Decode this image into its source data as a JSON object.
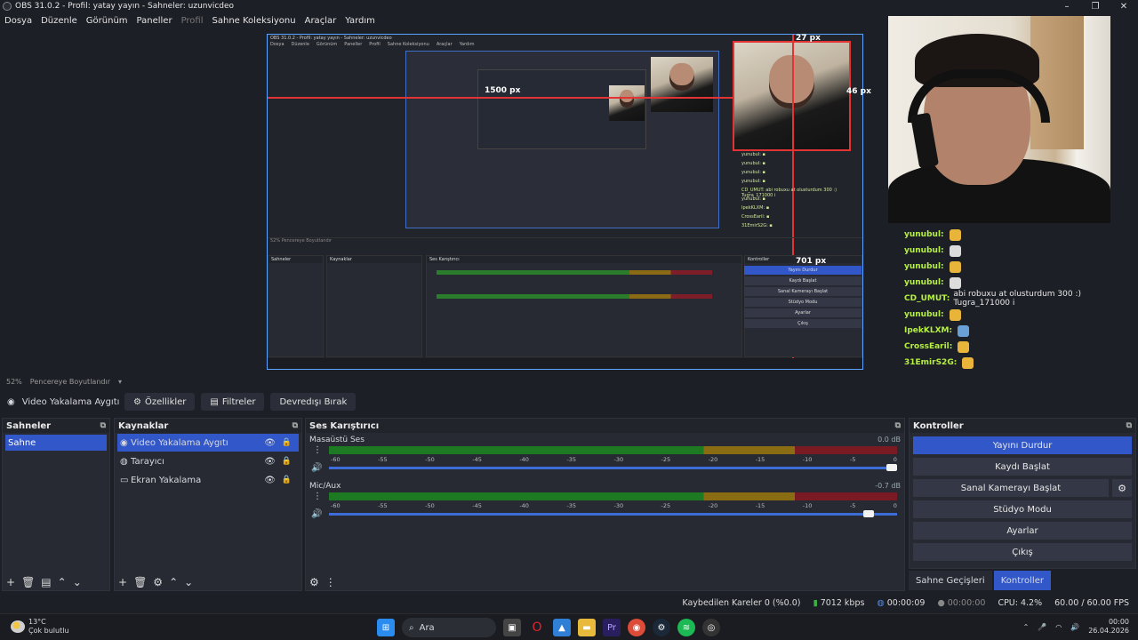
{
  "window": {
    "title": "OBS 31.0.2 - Profil: yatay yayın - Sahneler: uzunvicdeo"
  },
  "menu": [
    "Dosya",
    "Düzenle",
    "Görünüm",
    "Paneller",
    "Profil",
    "Sahne Koleksiyonu",
    "Araçlar",
    "Yardım"
  ],
  "preview": {
    "measure_top": "27 px",
    "measure_left": "1500 px",
    "measure_right": "46 px",
    "measure_bottom": "701 px"
  },
  "chat": [
    {
      "user": "yunubul:",
      "text": "",
      "emote_color": "#e8b53a"
    },
    {
      "user": "yunubul:",
      "text": "",
      "emote_color": "#dcdcdc"
    },
    {
      "user": "yunubul:",
      "text": "",
      "emote_color": "#e8b53a"
    },
    {
      "user": "yunubul:",
      "text": "",
      "emote_color": "#dcdcdc"
    },
    {
      "user": "CD_UMUT:",
      "text": "abi robuxu at olusturdum 300 :) Tugra_171000 i",
      "emote_color": ""
    },
    {
      "user": "yunubul:",
      "text": "",
      "emote_color": "#e8b53a"
    },
    {
      "user": "IpekKLXM:",
      "text": "",
      "emote_color": "#6aa0d8"
    },
    {
      "user": "CrossEaril:",
      "text": "",
      "emote_color": "#e8b53a"
    },
    {
      "user": "31EmirS2G:",
      "text": "",
      "emote_color": "#e8b53a"
    }
  ],
  "zoom": {
    "level": "52%",
    "resize": "Pencereye Boyutlandır"
  },
  "source_toolbar": {
    "source_name": "Video Yakalama Aygıtı",
    "properties": "Özellikler",
    "filters": "Filtreler",
    "deactivate": "Devredışı Bırak"
  },
  "scenes": {
    "title": "Sahneler",
    "items": [
      "Sahne"
    ]
  },
  "sources": {
    "title": "Kaynaklar",
    "items": [
      {
        "label": "Video Yakalama Aygıtı",
        "icon": "camera-icon"
      },
      {
        "label": "Tarayıcı",
        "icon": "globe-icon"
      },
      {
        "label": "Ekran Yakalama",
        "icon": "monitor-icon"
      }
    ]
  },
  "mixer": {
    "title": "Ses Karıştırıcı",
    "channels": [
      {
        "name": "Masaüstü Ses",
        "db": "0.0 dB",
        "volume_fraction": 1.0
      },
      {
        "name": "Mic/Aux",
        "db": "-0.7 dB",
        "volume_fraction": 0.96
      }
    ],
    "ticks": [
      "-60",
      "-55",
      "-50",
      "-45",
      "-40",
      "-35",
      "-30",
      "-25",
      "-20",
      "-15",
      "-10",
      "-5",
      "0"
    ]
  },
  "controls": {
    "title": "Kontroller",
    "stop_stream": "Yayını Durdur",
    "start_record": "Kaydı Başlat",
    "virtual_cam": "Sanal Kamerayı Başlat",
    "studio_mode": "Stüdyo Modu",
    "settings": "Ayarlar",
    "exit": "Çıkış"
  },
  "tabs": {
    "transitions": "Sahne Geçişleri",
    "controls": "Kontroller"
  },
  "status": {
    "dropped": "Kaybedilen Kareler 0 (%0.0)",
    "bitrate": "7012 kbps",
    "stream_time": "00:00:09",
    "rec_time": "00:00:00",
    "cpu": "CPU: 4.2%",
    "fps": "60.00 / 60.00 FPS"
  },
  "taskbar": {
    "temp": "13°C",
    "weather": "Çok bulutlu",
    "search": "Ara",
    "time": "00:00",
    "date": "26.04.2026"
  },
  "colors": {
    "accent": "#3257c9",
    "bg": "#1d1f26",
    "panel": "#272a33"
  }
}
